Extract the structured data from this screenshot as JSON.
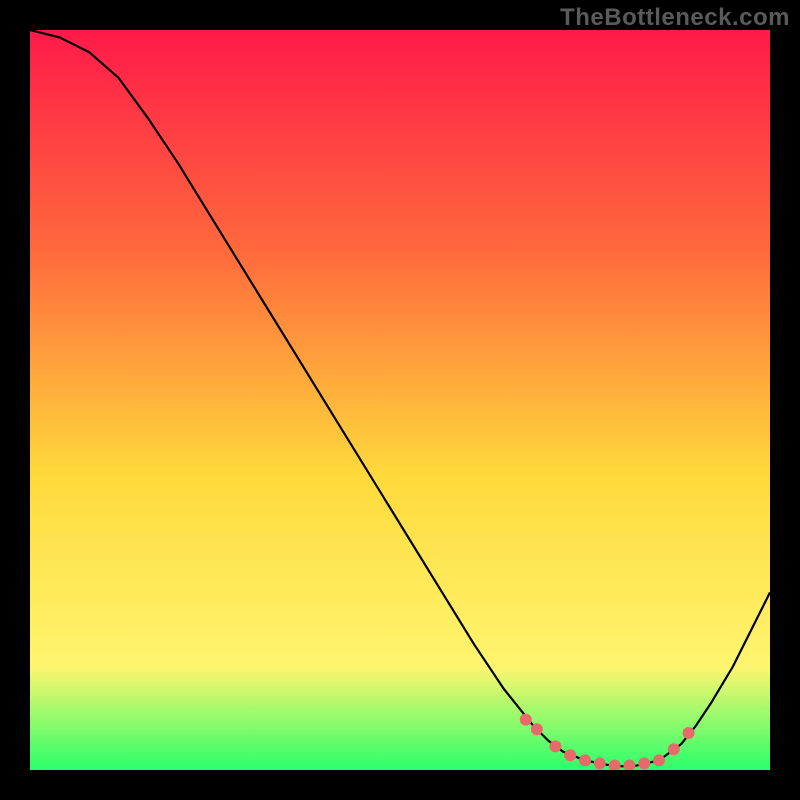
{
  "watermark": "TheBottleneck.com",
  "colors": {
    "frame": "#000000",
    "watermark": "#5a5a5a",
    "gradient_top": "#ff1a49",
    "gradient_mid1": "#ff6a3c",
    "gradient_mid2": "#ffd93b",
    "gradient_mid3": "#fff56f",
    "gradient_bottom": "#2aff6a",
    "curve": "#000000",
    "marker": "#e66a6a"
  },
  "chart_data": {
    "type": "line",
    "title": "",
    "xlabel": "",
    "ylabel": "",
    "xlim": [
      0,
      100
    ],
    "ylim": [
      0,
      100
    ],
    "grid": false,
    "legend": false,
    "series": [
      {
        "name": "bottleneck-curve",
        "x": [
          0,
          4,
          8,
          12,
          16,
          20,
          24,
          28,
          32,
          36,
          40,
          44,
          48,
          52,
          56,
          60,
          64,
          68,
          70,
          72,
          75,
          78,
          80,
          82,
          85,
          88,
          90,
          92,
          95,
          100
        ],
        "values": [
          100,
          99,
          97,
          93.5,
          88,
          82,
          75.5,
          69,
          62.5,
          56,
          49.5,
          43,
          36.5,
          30,
          23.5,
          17,
          11,
          6,
          4,
          2.5,
          1.3,
          0.7,
          0.5,
          0.6,
          1.3,
          3.5,
          6,
          9,
          14,
          24
        ]
      }
    ],
    "markers": {
      "name": "highlight-dots",
      "x": [
        67,
        68.5,
        71,
        73,
        75,
        77,
        79,
        81,
        83,
        85,
        87,
        89
      ],
      "values": [
        6.8,
        5.5,
        3.2,
        2.0,
        1.3,
        0.9,
        0.6,
        0.6,
        0.9,
        1.3,
        2.8,
        5.0
      ]
    }
  }
}
